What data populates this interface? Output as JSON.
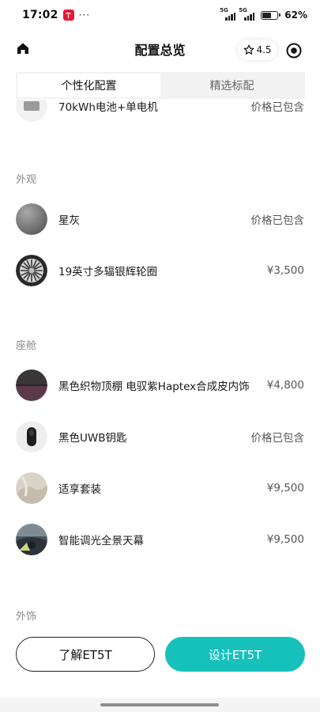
{
  "status_bar": {
    "time": "17:02",
    "more": "···",
    "signal1_label": "5G",
    "signal2_label": "5G",
    "battery_percent": 62,
    "battery_text": "62%"
  },
  "header": {
    "title": "配置总览",
    "rating": "4.5"
  },
  "tabs": [
    {
      "label": "个性化配置",
      "active": true
    },
    {
      "label": "精选标配",
      "active": false
    }
  ],
  "partial_row": {
    "label": "70kWh电池+单电机",
    "price": "价格已包含"
  },
  "sections": {
    "exterior": {
      "title": "外观",
      "items": [
        {
          "label": "星灰",
          "price": "价格已包含",
          "icon": "paint-swatch-icon"
        },
        {
          "label": "19英寸多辐银辉轮圈",
          "price": "¥3,500",
          "icon": "wheel-rim-icon"
        }
      ]
    },
    "cabin": {
      "title": "座舱",
      "items": [
        {
          "label": "黑色织物顶棚 电驭紫Haptex合成皮内饰",
          "price": "¥4,800",
          "icon": "interior-swatch-icon"
        },
        {
          "label": "黑色UWB钥匙",
          "price": "价格已包含",
          "icon": "car-key-icon"
        },
        {
          "label": "适享套装",
          "price": "¥9,500",
          "icon": "seat-package-icon"
        },
        {
          "label": "智能调光全景天幕",
          "price": "¥9,500",
          "icon": "panoramic-roof-icon"
        }
      ]
    },
    "accessories": {
      "title": "外饰"
    }
  },
  "buttons": {
    "learn": "了解ET5T",
    "design": "设计ET5T"
  },
  "colors": {
    "accent": "#16c1bc",
    "app_icon": "#e31937"
  }
}
